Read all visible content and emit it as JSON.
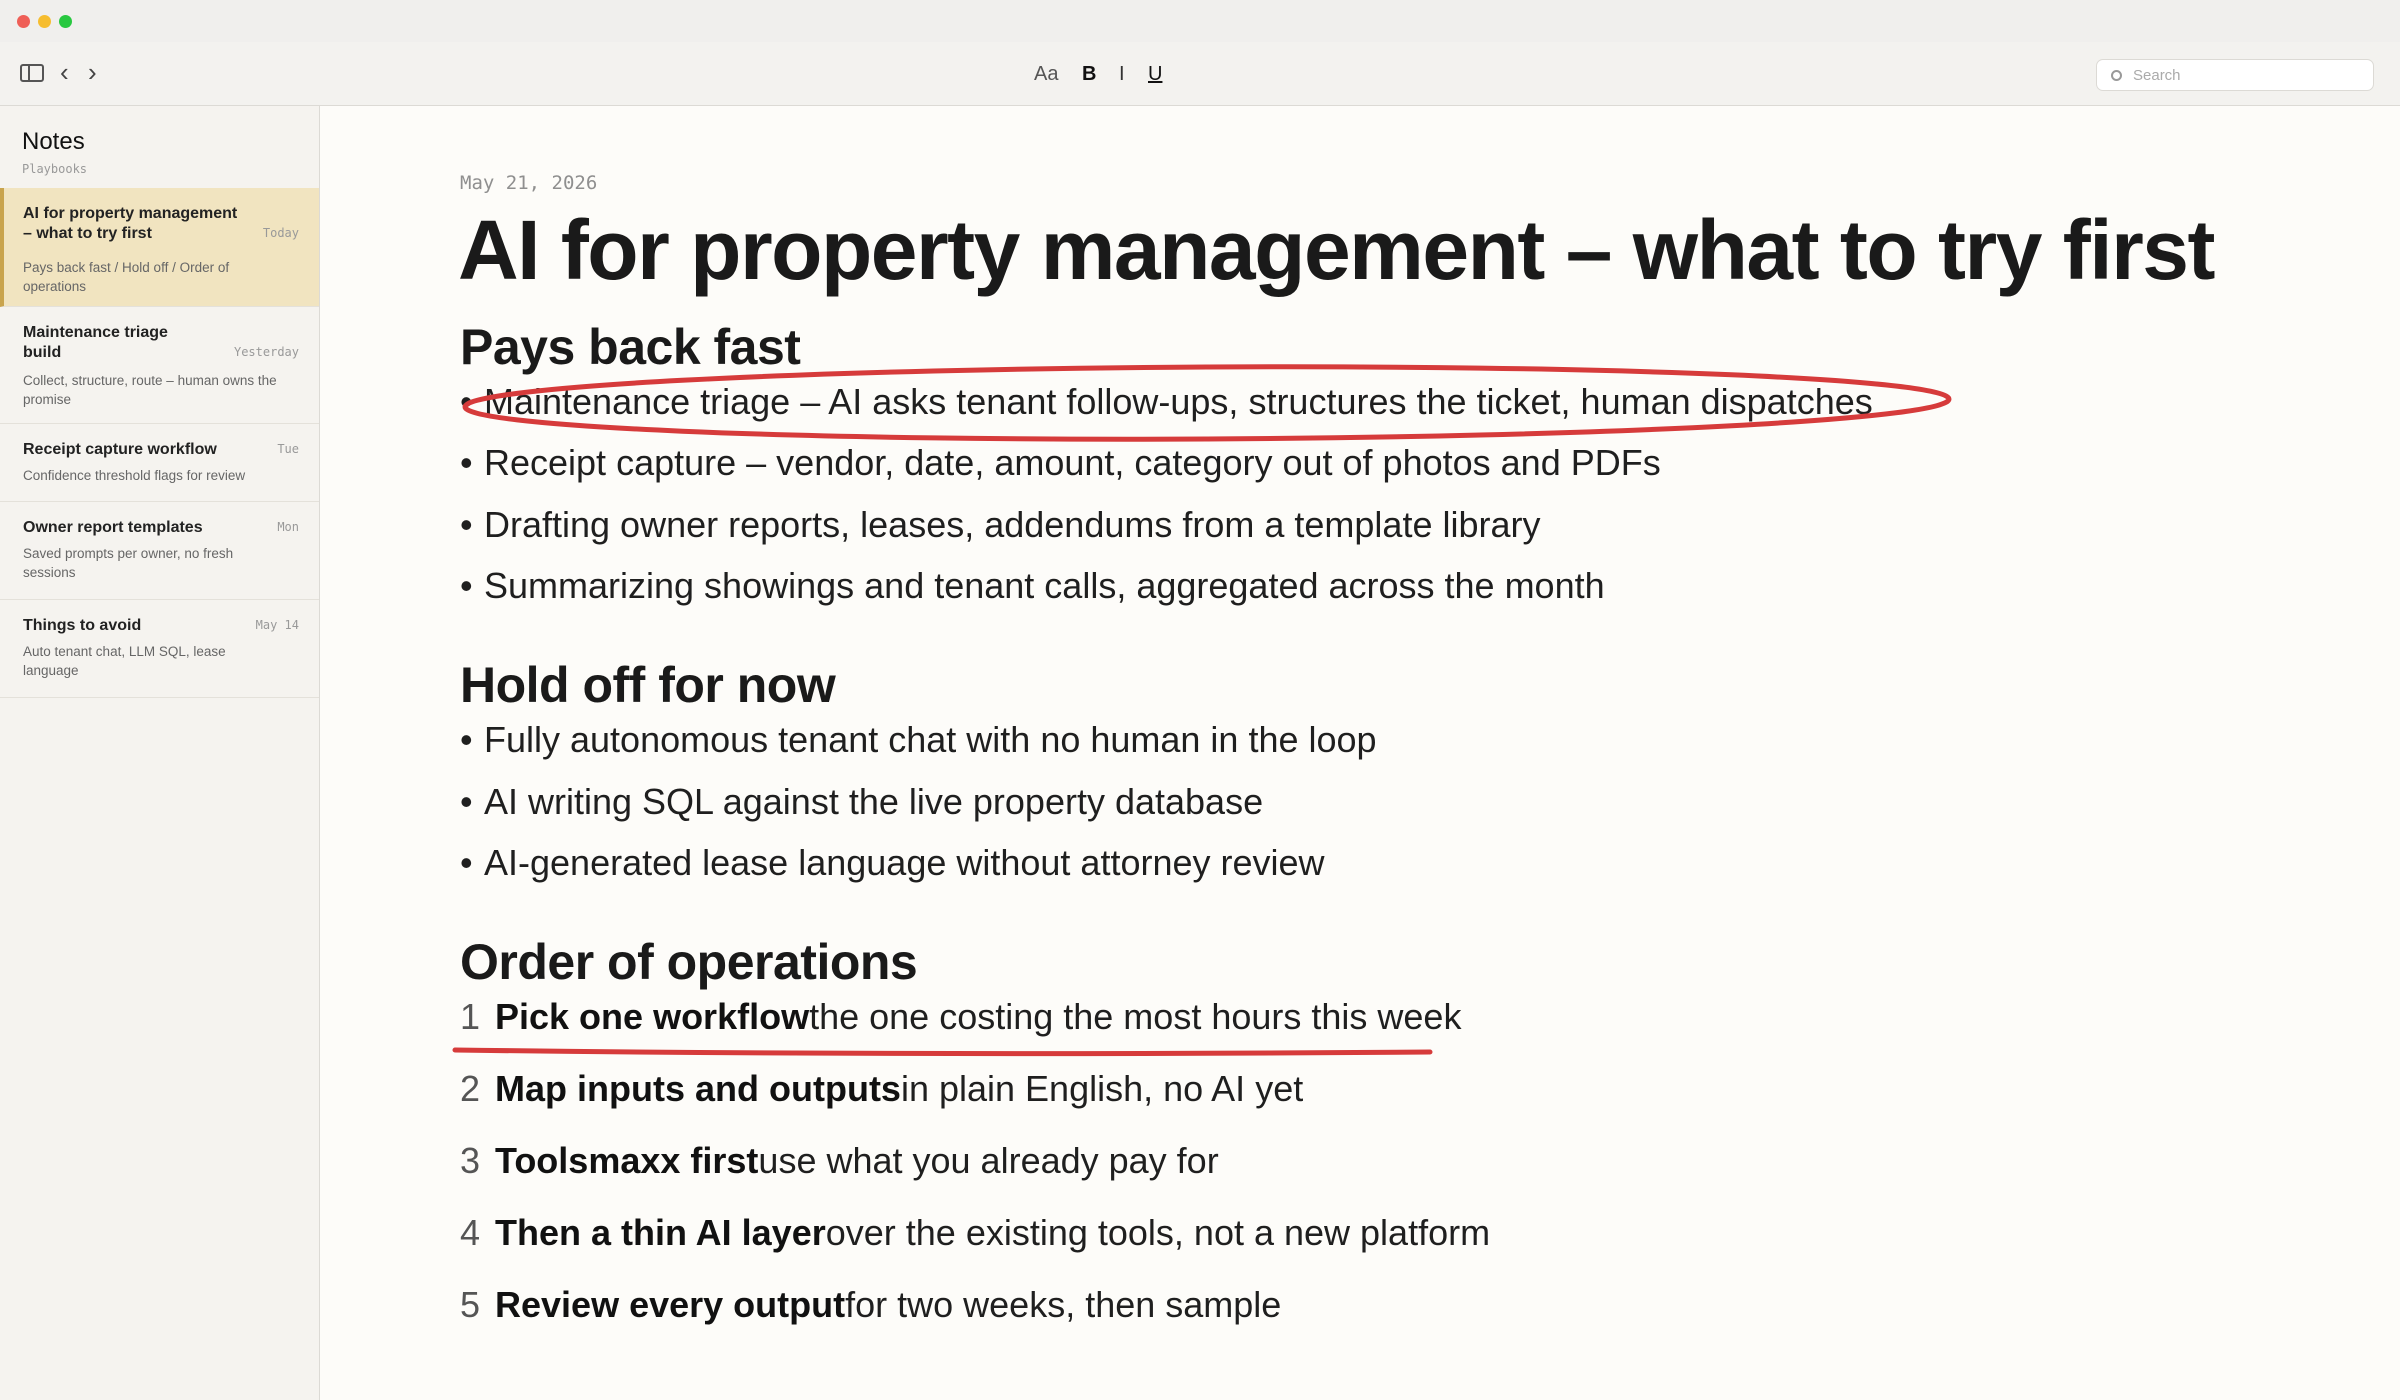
{
  "toolbar": {
    "back_glyph": "‹",
    "forward_glyph": "›",
    "font_label": "Aa",
    "bold_label": "B",
    "italic_label": "I",
    "underline_label": "U",
    "search_placeholder": "Search"
  },
  "sidebar": {
    "title": "Notes",
    "subtitle": "Playbooks",
    "notes": [
      {
        "title": "AI for property management – what to try first",
        "date": "Today",
        "snippet": "Pays back fast / Hold off / Order of operations",
        "active": true
      },
      {
        "title": "Maintenance triage build",
        "date": "Yesterday",
        "snippet": "Collect, structure, route – human owns the promise"
      },
      {
        "title": "Receipt capture workflow",
        "date": "Tue",
        "snippet": "Confidence threshold flags for review"
      },
      {
        "title": "Owner report templates",
        "date": "Mon",
        "snippet": "Saved prompts per owner, no fresh sessions"
      },
      {
        "title": "Things to avoid",
        "date": "May 14",
        "snippet": "Auto tenant chat, LLM SQL, lease language"
      }
    ]
  },
  "document": {
    "date": "May 21, 2026",
    "title": "AI for property management – what to try first",
    "bullet_glyph": "•",
    "sections": [
      {
        "heading": "Pays back fast",
        "bullets": [
          "Maintenance triage – AI asks tenant follow-ups, structures the ticket, human dispatches",
          "Receipt capture – vendor, date, amount, category out of photos and PDFs",
          "Drafting owner reports, leases, addendums from a template library",
          "Summarizing showings and tenant calls, aggregated across the month"
        ]
      },
      {
        "heading": "Hold off for now",
        "bullets": [
          "Fully autonomous tenant chat with no human in the loop",
          "AI writing SQL against the live property database",
          "AI-generated lease language without attorney review"
        ]
      },
      {
        "heading": "Order of operations",
        "steps": [
          {
            "num": "1",
            "bold": "Pick one workflow",
            "rest": "the one costing the most hours this week"
          },
          {
            "num": "2",
            "bold": "Map inputs and outputs",
            "rest": "in plain English, no AI yet"
          },
          {
            "num": "3",
            "bold": "Toolsmaxx first",
            "rest": "use what you already pay for"
          },
          {
            "num": "4",
            "bold": "Then a thin AI layer",
            "rest": "over the existing tools, not a new platform"
          },
          {
            "num": "5",
            "bold": "Review every output",
            "rest": "for two weeks, then sample"
          }
        ]
      }
    ]
  },
  "colors": {
    "annotation_red": "#d63b3b",
    "active_note_bg": "#f1e4c0",
    "active_note_bar": "#c9a44d"
  }
}
